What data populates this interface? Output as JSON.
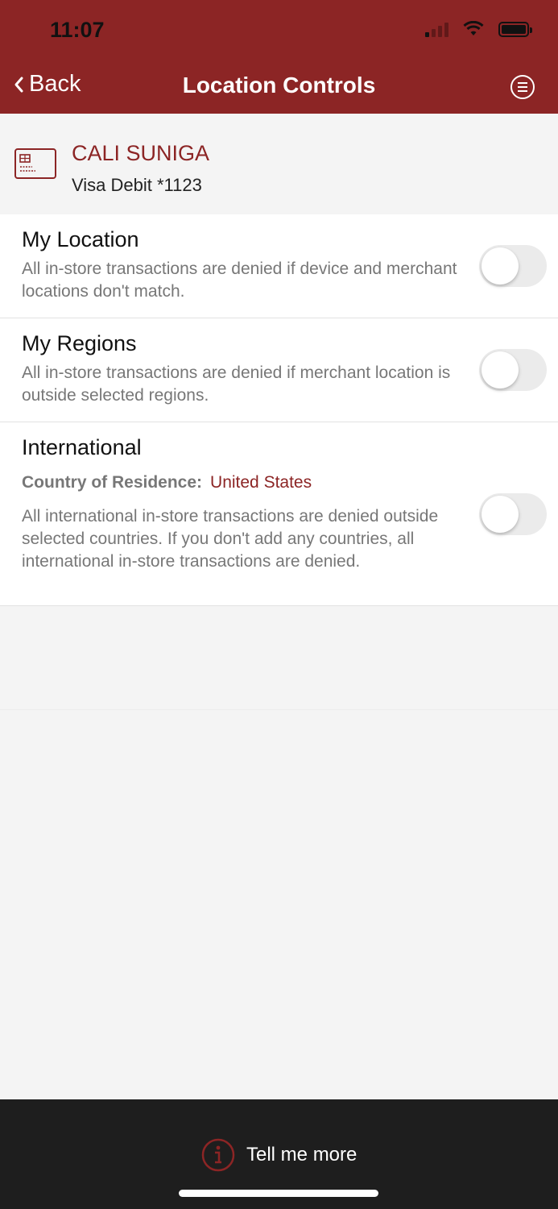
{
  "status_bar": {
    "time": "11:07"
  },
  "nav": {
    "back_label": "Back",
    "title": "Location Controls"
  },
  "account": {
    "name": "CALI SUNIGA",
    "card": "Visa Debit *1123"
  },
  "controls": [
    {
      "title": "My Location",
      "description": "All in-store transactions are denied if device and merchant locations don't match.",
      "enabled": false
    },
    {
      "title": "My Regions",
      "description": "All in-store transactions are denied if merchant location is outside selected regions.",
      "enabled": false
    },
    {
      "title": "International",
      "residence_label": "Country of Residence:",
      "residence_value": "United States",
      "description": "All international in-store transactions are denied outside selected countries. If you don't add any countries, all international in-store transactions are denied.",
      "enabled": false
    }
  ],
  "footer": {
    "tell_more_label": "Tell me more"
  },
  "colors": {
    "brand": "#8c2525",
    "footer_bg": "#1e1e1e",
    "page_bg": "#f4f4f4"
  }
}
